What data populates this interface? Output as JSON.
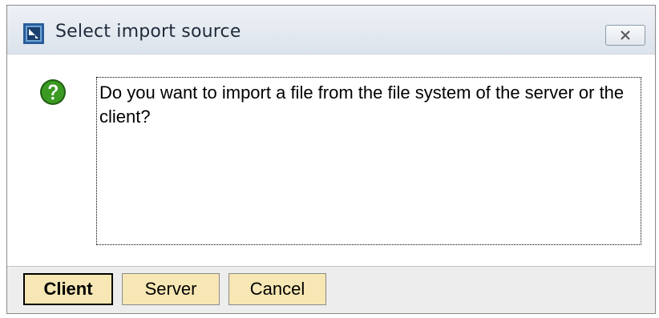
{
  "dialog": {
    "title": "Select import source",
    "close_icon": "close-x-icon",
    "message": "Do you want to import a file from the file system of the server or the client?",
    "question_icon": "question-icon"
  },
  "buttons": {
    "client": "Client",
    "server": "Server",
    "cancel": "Cancel"
  },
  "colors": {
    "button_face": "#f7e7b4",
    "question_green": "#2e8b1f"
  }
}
